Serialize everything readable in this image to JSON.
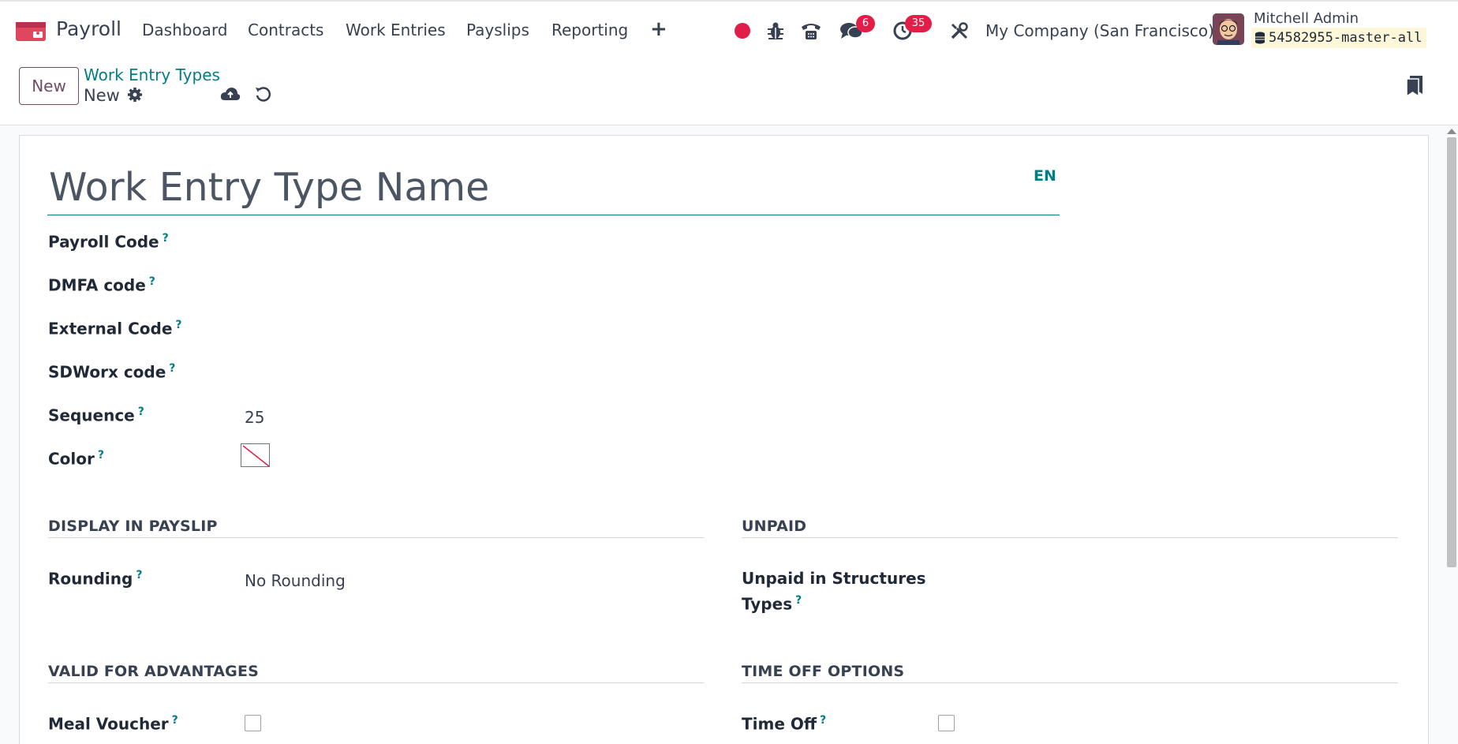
{
  "navbar": {
    "app_name": "Payroll",
    "menu": [
      "Dashboard",
      "Contracts",
      "Work Entries",
      "Payslips",
      "Reporting"
    ],
    "messages_badge": "6",
    "activities_badge": "35",
    "company": "My Company (San Francisco)",
    "user_name": "Mitchell Admin",
    "database": "54582955-master-all"
  },
  "control": {
    "new_label": "New",
    "breadcrumb": "Work Entry Types",
    "record_name": "New"
  },
  "form": {
    "name_placeholder": "Work Entry Type Name",
    "lang": "EN",
    "fields": {
      "payroll_code": "Payroll Code",
      "dmfa_code": "DMFA code",
      "external_code": "External Code",
      "sdworx_code": "SDWorx code",
      "sequence": "Sequence",
      "sequence_value": "25",
      "color": "Color"
    },
    "sections": {
      "display_in_payslip": "DISPLAY IN PAYSLIP",
      "unpaid": "UNPAID",
      "valid_for_advantages": "VALID FOR ADVANTAGES",
      "time_off_options": "TIME OFF OPTIONS"
    },
    "rounding_label": "Rounding",
    "rounding_value": "No Rounding",
    "unpaid_structures_label_line1": "Unpaid in Structures",
    "unpaid_structures_label_line2": "Types",
    "meal_voucher_label": "Meal Voucher",
    "time_off_label": "Time Off",
    "help_mark": "?"
  },
  "colors": {
    "brand": "#714b67",
    "link": "#017e84",
    "badge": "#e11d48",
    "record_dot": "#e11d48"
  }
}
